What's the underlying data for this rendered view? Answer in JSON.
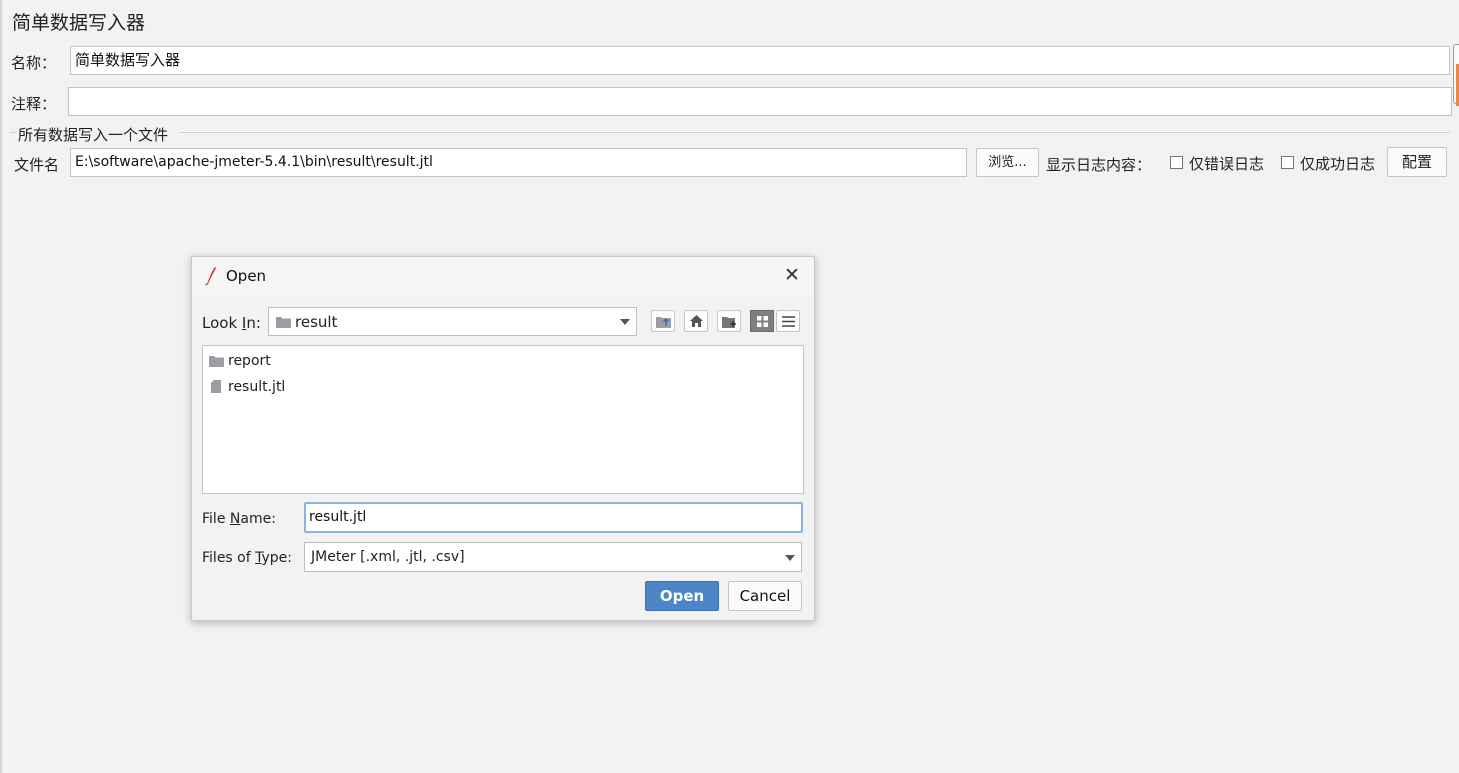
{
  "panel": {
    "title": "简单数据写入器",
    "name_label": "名称：",
    "name_value": "简单数据写入器",
    "comment_label": "注释：",
    "comment_value": "",
    "group_title": "所有数据写入一个文件",
    "filename_label": "文件名",
    "filename_value": "E:\\software\\apache-jmeter-5.4.1\\bin\\result\\result.jtl",
    "browse_label": "浏览...",
    "log_label": "显示日志内容：",
    "errors_only_label": "仅错误日志",
    "success_only_label": "仅成功日志",
    "configure_label": "配置"
  },
  "dialog": {
    "title": "Open",
    "look_in_label_pre": "Look ",
    "look_in_label_mnemonic": "I",
    "look_in_label_post": "n:",
    "look_in_value": "result",
    "files": [
      {
        "name": "report",
        "icon": "folder-icon"
      },
      {
        "name": "result.jtl",
        "icon": "file-icon"
      }
    ],
    "file_name_label_pre": "File ",
    "file_name_label_mnemonic": "N",
    "file_name_label_post": "ame:",
    "file_name_value": "result.jtl",
    "file_type_label_pre": "Files of ",
    "file_type_label_mnemonic": "T",
    "file_type_label_post": "ype:",
    "file_type_value": "JMeter [.xml, .jtl, .csv]",
    "open_label": "Open",
    "cancel_label": "Cancel"
  },
  "colors": {
    "accent": "#4b86c9",
    "background": "#f2f2f2",
    "scroll_thumb": "#e8874a"
  }
}
